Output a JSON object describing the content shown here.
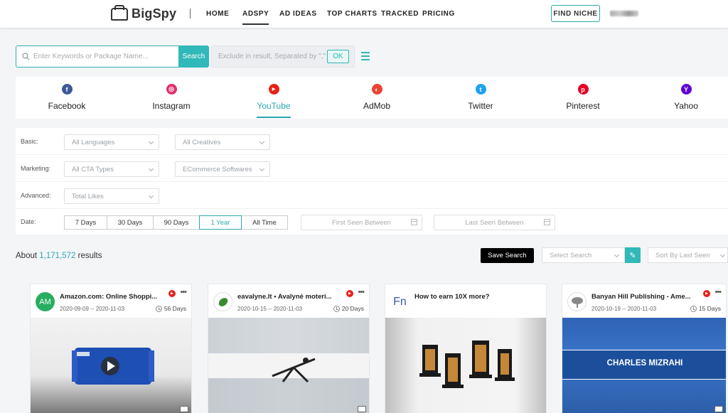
{
  "brand": {
    "name": "BigSpy"
  },
  "nav": {
    "items": [
      {
        "label": "HOME",
        "active": false
      },
      {
        "label": "ADSPY",
        "active": true
      },
      {
        "label": "AD IDEAS",
        "active": false
      },
      {
        "label": "TOP CHARTS",
        "active": false
      },
      {
        "label": "TRACKED",
        "active": false
      },
      {
        "label": "PRICING",
        "active": false
      }
    ],
    "find_niche": "FIND NICHE"
  },
  "search": {
    "placeholder": "Enter Keywords or Package Name...",
    "button": "Search",
    "exclude_placeholder": "Exclude in result, Separated by \",\"",
    "ok": "OK"
  },
  "platforms": [
    {
      "label": "Facebook",
      "icon": "facebook-icon",
      "color": "#3b5998",
      "glyph": "f",
      "active": false
    },
    {
      "label": "Instagram",
      "icon": "instagram-icon",
      "color": "#e1306c",
      "glyph": "◎",
      "active": false
    },
    {
      "label": "YouTube",
      "icon": "youtube-icon",
      "color": "#e62117",
      "glyph": "▶",
      "active": true
    },
    {
      "label": "AdMob",
      "icon": "admob-icon",
      "color": "#ea4335",
      "glyph": "◐",
      "active": false
    },
    {
      "label": "Twitter",
      "icon": "twitter-icon",
      "color": "#1da1f2",
      "glyph": "t",
      "active": false
    },
    {
      "label": "Pinterest",
      "icon": "pinterest-icon",
      "color": "#e60023",
      "glyph": "p",
      "active": false
    },
    {
      "label": "Yahoo",
      "icon": "yahoo-icon",
      "color": "#6001d2",
      "glyph": "Y",
      "active": false
    }
  ],
  "filters": {
    "basic": {
      "label": "Basic:",
      "languages": "All Languages",
      "creatives": "All Creatives"
    },
    "marketing": {
      "label": "Marketing:",
      "cta": "All CTA Types",
      "software": "ECommerce Softwares"
    },
    "advanced": {
      "label": "Advanced:",
      "likes": "Total Likes"
    },
    "date": {
      "label": "Date:",
      "options": [
        "7 Days",
        "30 Days",
        "90 Days",
        "1 Year",
        "All Time"
      ],
      "selected": "1 Year",
      "first_seen": "First Seen Between",
      "last_seen": "Last Seen Between"
    }
  },
  "results": {
    "prefix": "About ",
    "count": "1,171,572",
    "suffix": " results"
  },
  "toolbar": {
    "save_search": "Save Search",
    "select_search": "Select Search",
    "sort": "Sort By Last Seen"
  },
  "cards": [
    {
      "title": "Amazon.com: Online Shoppi...",
      "dates": "2020-09-09 -- 2020-11-03",
      "days": "56 Days",
      "avatar_text": "AM",
      "avatar_color": "#27ae60"
    },
    {
      "title": "eavalyne.lt • Avalynė moteri...",
      "dates": "2020-10-15 -- 2020-11-03",
      "days": "20 Days",
      "avatar_text": "",
      "avatar_color": "#3a8a2e"
    },
    {
      "title": "How to earn 10X more?",
      "dates": "",
      "days": "",
      "avatar_text": "Fn",
      "avatar_color": "#ffffff"
    },
    {
      "title": "Banyan Hill Publishing - Ame...",
      "dates": "2020-10-19 -- 2020-11-03",
      "days": "15 Days",
      "avatar_text": "",
      "avatar_color": "#888888",
      "banner": "CHARLES MIZRAHI"
    }
  ],
  "colors": {
    "accent": "#31b8b8",
    "youtube": "#e62117"
  }
}
